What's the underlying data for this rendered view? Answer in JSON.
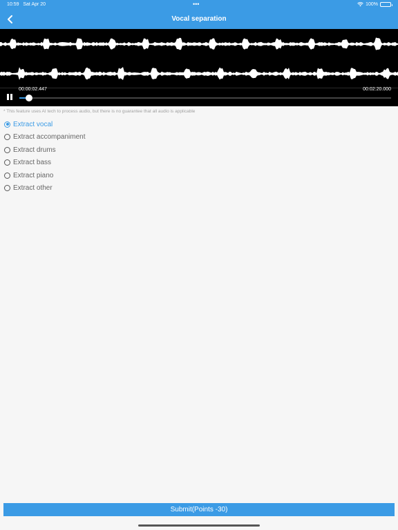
{
  "status_bar": {
    "time": "10:59",
    "date": "Sat Apr 20",
    "dots": "•••",
    "battery": "100%"
  },
  "header": {
    "title": "Vocal separation"
  },
  "player": {
    "current_time": "00:00:02.447",
    "total_time": "00:02:20.000",
    "progress": 0.017
  },
  "note": "* This feature uses AI tech to process audio, but there is no guarantee that all audio is applicable",
  "options": [
    {
      "label": "Extract vocal",
      "selected": true
    },
    {
      "label": "Extract accompaniment",
      "selected": false
    },
    {
      "label": "Extract drums",
      "selected": false
    },
    {
      "label": "Extract bass",
      "selected": false
    },
    {
      "label": "Extract piano",
      "selected": false
    },
    {
      "label": "Extract other",
      "selected": false
    }
  ],
  "submit_label": "Submit(Points -30)",
  "colors": {
    "accent": "#3b9be5",
    "player_bg": "#000000",
    "page_bg": "#f6f6f6"
  }
}
